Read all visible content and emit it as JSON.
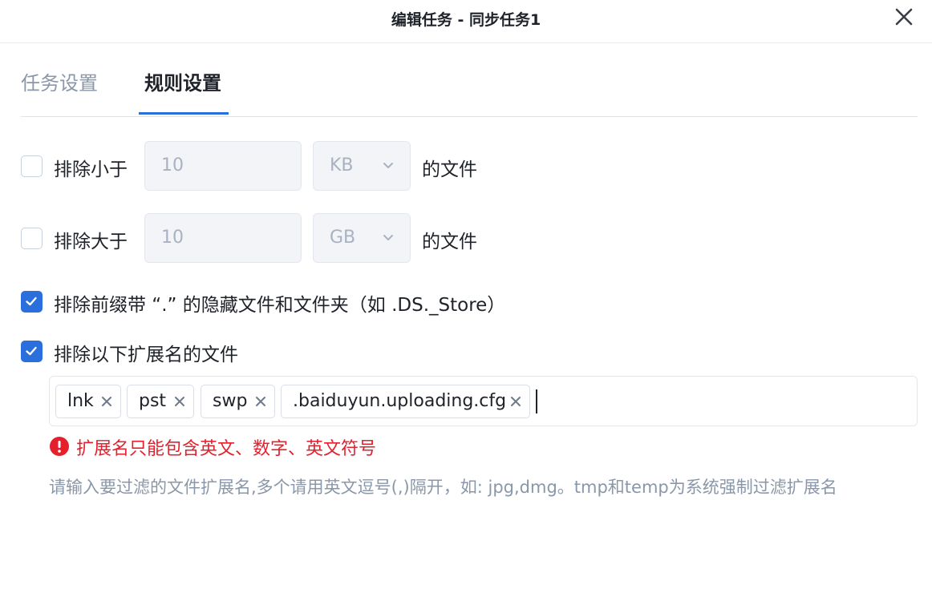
{
  "dialog": {
    "title": "编辑任务 - 同步任务1"
  },
  "tabs": [
    {
      "label": "任务设置",
      "active": false
    },
    {
      "label": "规则设置",
      "active": true
    }
  ],
  "rules": {
    "exclude_smaller": {
      "checked": false,
      "label": "排除小于",
      "value": "10",
      "unit": "KB",
      "suffix": "的文件"
    },
    "exclude_larger": {
      "checked": false,
      "label": "排除大于",
      "value": "10",
      "unit": "GB",
      "suffix": "的文件"
    },
    "exclude_hidden": {
      "checked": true,
      "label": "排除前缀带 “.” 的隐藏文件和文件夹（如 .DS._Store）"
    },
    "exclude_ext": {
      "checked": true,
      "label": "排除以下扩展名的文件",
      "tags": [
        "lnk",
        "pst",
        "swp",
        ".baiduyun.uploading.cfg"
      ],
      "error": "扩展名只能包含英文、数字、英文符号",
      "hint": "请输入要过滤的文件扩展名,多个请用英文逗号(,)隔开，如: jpg,dmg。tmp和temp为系统强制过滤扩展名"
    }
  },
  "colors": {
    "accent": "#2b6fdc",
    "error": "#e5202c",
    "muted": "#8a97a8"
  }
}
